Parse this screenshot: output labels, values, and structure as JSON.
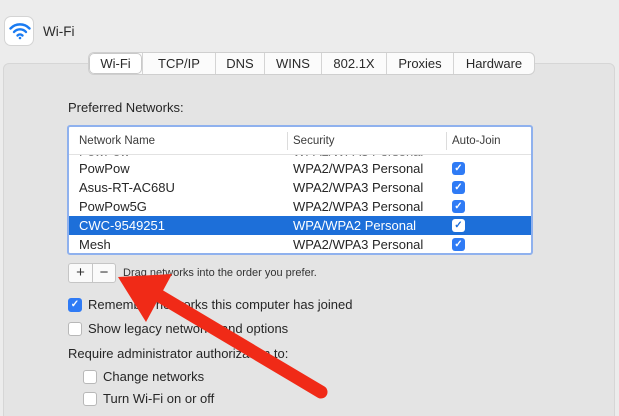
{
  "window": {
    "title": "Wi-Fi",
    "icon": "wifi-icon"
  },
  "tabs": [
    {
      "label": "Wi-Fi",
      "active": true
    },
    {
      "label": "TCP/IP"
    },
    {
      "label": "DNS"
    },
    {
      "label": "WINS"
    },
    {
      "label": "802.1X"
    },
    {
      "label": "Proxies"
    },
    {
      "label": "Hardware"
    }
  ],
  "preferred": {
    "label": "Preferred Networks:",
    "columns": [
      "Network Name",
      "Security",
      "Auto-Join"
    ],
    "rows": [
      {
        "name": "PowPow",
        "security": "WPA2/WPA3 Personal",
        "auto_join": true
      },
      {
        "name": "Asus-RT-AC68U",
        "security": "WPA2/WPA3 Personal",
        "auto_join": true
      },
      {
        "name": "PowPow5G",
        "security": "WPA2/WPA3 Personal",
        "auto_join": true
      },
      {
        "name": "CWC-9549251",
        "security": "WPA/WPA2 Personal",
        "auto_join": true,
        "selected": true
      },
      {
        "name": "Mesh",
        "security": "WPA2/WPA3 Personal",
        "auto_join": true
      }
    ],
    "add_label": "+",
    "remove_label": "−",
    "drag_hint": "Drag networks into the order you prefer."
  },
  "options": {
    "remember": {
      "label": "Remember networks this computer has joined",
      "checked": true
    },
    "legacy": {
      "label": "Show legacy networks and options",
      "checked": false
    },
    "require_label": "Require administrator authorization to:",
    "change_networks": {
      "label": "Change networks",
      "checked": false
    },
    "turn_wifi": {
      "label": "Turn Wi-Fi on or off",
      "checked": false
    }
  },
  "colors": {
    "accent": "#2f7bf5",
    "selection": "#1d6fd9",
    "annotation_arrow": "#f02a17"
  },
  "checkmark_glyph": "✓"
}
